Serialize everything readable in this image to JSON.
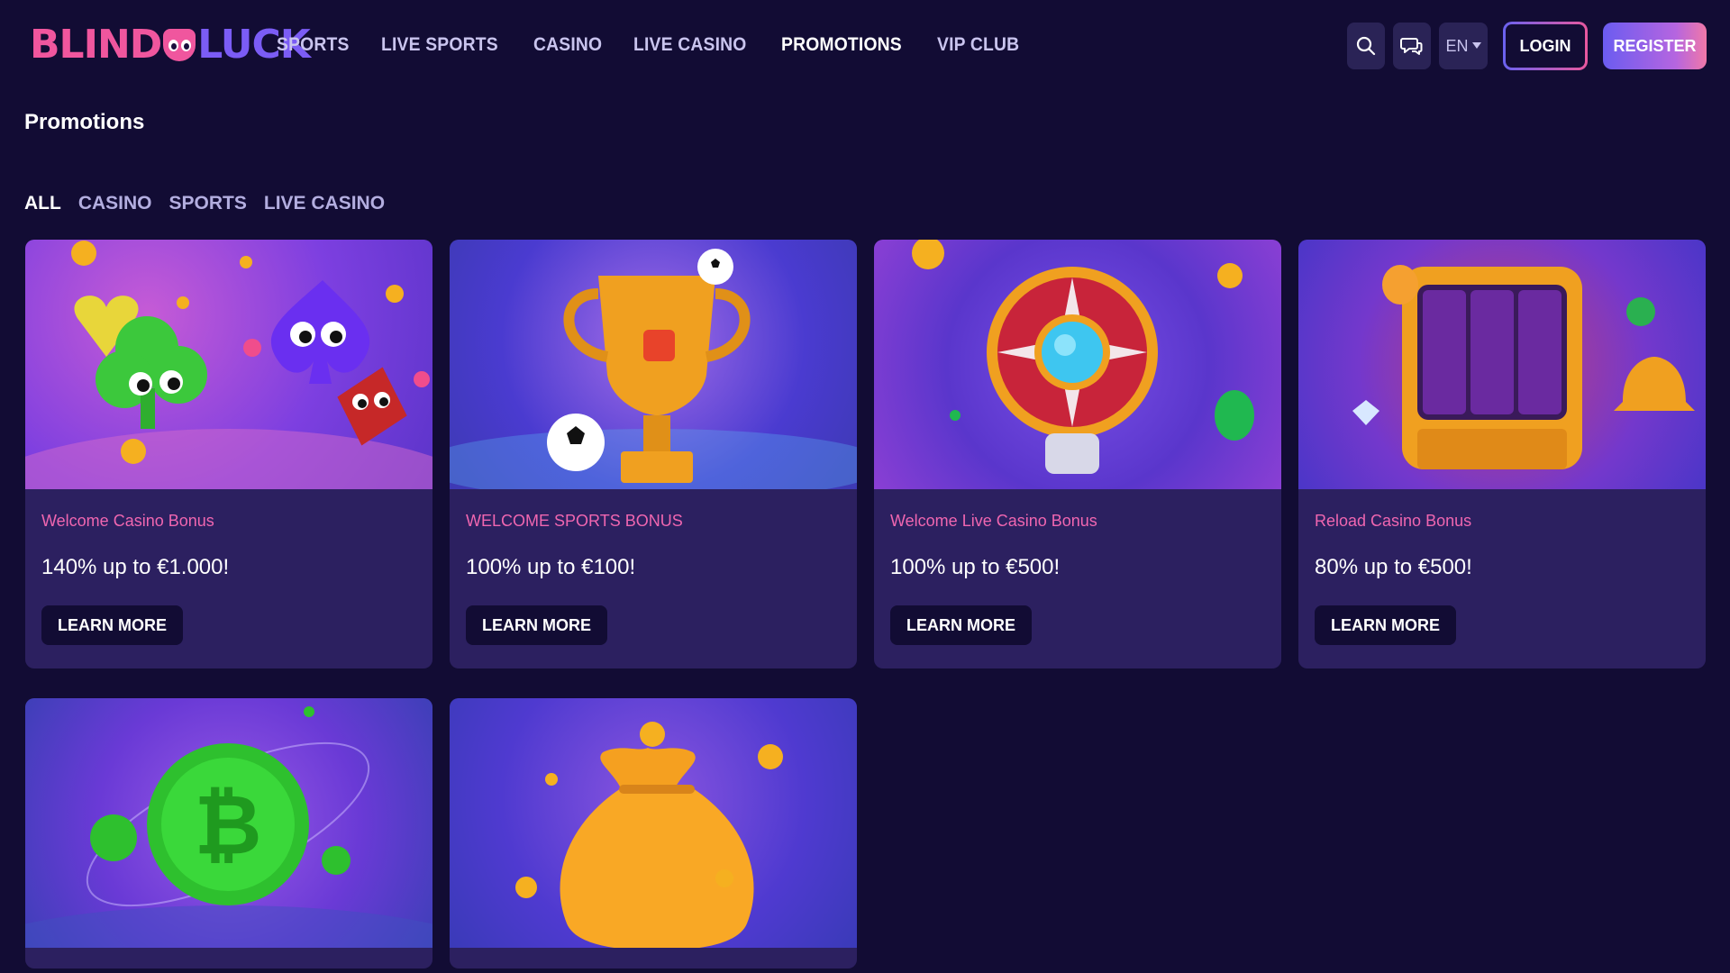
{
  "brand": {
    "part1": "BLIND",
    "part2": "LUCK"
  },
  "nav": [
    {
      "label": "SPORTS",
      "active": false
    },
    {
      "label": "LIVE SPORTS",
      "active": false
    },
    {
      "label": "CASINO",
      "active": false
    },
    {
      "label": "LIVE CASINO",
      "active": false
    },
    {
      "label": "PROMOTIONS",
      "active": true
    },
    {
      "label": "VIP CLUB",
      "active": false
    }
  ],
  "header": {
    "search_icon": "search-icon",
    "chat_icon": "chat-icon",
    "language": "EN",
    "login_label": "LOGIN",
    "register_label": "REGISTER"
  },
  "page": {
    "title": "Promotions"
  },
  "filters": [
    {
      "label": "ALL",
      "active": true
    },
    {
      "label": "CASINO",
      "active": false
    },
    {
      "label": "SPORTS",
      "active": false
    },
    {
      "label": "LIVE CASINO",
      "active": false
    }
  ],
  "promotions": [
    {
      "label": "Welcome Casino Bonus",
      "offer": "140% up to €1.000!",
      "button": "LEARN MORE",
      "image": "card-suits-illustration"
    },
    {
      "label": "WELCOME SPORTS BONUS",
      "offer": "100% up to €100!",
      "button": "LEARN MORE",
      "image": "trophy-soccer-illustration"
    },
    {
      "label": "Welcome Live Casino Bonus",
      "offer": "100% up to €500!",
      "button": "LEARN MORE",
      "image": "roulette-wheel-illustration"
    },
    {
      "label": "Reload Casino Bonus",
      "offer": "80% up to €500!",
      "button": "LEARN MORE",
      "image": "slot-machine-illustration"
    },
    {
      "image": "bitcoin-coin-illustration"
    },
    {
      "image": "money-bag-illustration"
    }
  ],
  "colors": {
    "background": "#120c34",
    "card": "#2c2060",
    "accent_pink": "#f066b0",
    "accent_purple": "#6b5cf0"
  }
}
